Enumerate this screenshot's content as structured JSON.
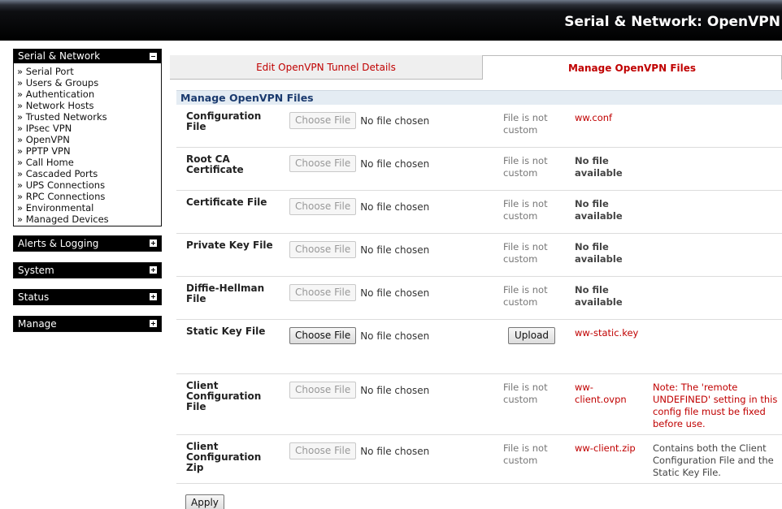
{
  "header": {
    "title": "Serial & Network: OpenVPN"
  },
  "sidebar": {
    "main_menu": {
      "title": "Serial & Network",
      "items": [
        "Serial Port",
        "Users & Groups",
        "Authentication",
        "Network Hosts",
        "Trusted Networks",
        "IPsec VPN",
        "OpenVPN",
        "PPTP VPN",
        "Call Home",
        "Cascaded Ports",
        "UPS Connections",
        "RPC Connections",
        "Environmental",
        "Managed Devices"
      ]
    },
    "collapsed_menus": [
      "Alerts & Logging",
      "System",
      "Status",
      "Manage"
    ]
  },
  "tabs": {
    "edit": "Edit OpenVPN Tunnel Details",
    "manage": "Manage OpenVPN Files"
  },
  "section": {
    "title": "Manage OpenVPN Files"
  },
  "common": {
    "choose_file": "Choose File",
    "no_file_chosen": "No file chosen",
    "upload": "Upload",
    "apply": "Apply"
  },
  "files": [
    {
      "label": "Configuration File",
      "status": "File is not custom",
      "file": "ww.conf",
      "note": ""
    },
    {
      "label": "Root CA Certificate",
      "status": "File is not custom",
      "file": "No file available",
      "note": ""
    },
    {
      "label": "Certificate File",
      "status": "File is not custom",
      "file": "No file available",
      "note": ""
    },
    {
      "label": "Private Key File",
      "status": "File is not custom",
      "file": "No file available",
      "note": ""
    },
    {
      "label": "Diffie-Hellman File",
      "status": "File is not custom",
      "file": "No file available",
      "note": ""
    },
    {
      "label": "Static Key File",
      "status": "",
      "file": "ww-static.key",
      "note": ""
    },
    {
      "label": "Client Configuration File",
      "status": "File is not custom",
      "file": "ww-client.ovpn",
      "note": "Note: The 'remote UNDEFINED' setting in this config file must be fixed before use."
    },
    {
      "label": "Client Configuration Zip",
      "status": "File is not custom",
      "file": "ww-client.zip",
      "note": "Contains both the Client Configuration File and the Static Key File."
    }
  ],
  "colors": {
    "accent_red": "#c00000",
    "section_blue": "#1a3a6e",
    "topbar": "#000000"
  }
}
